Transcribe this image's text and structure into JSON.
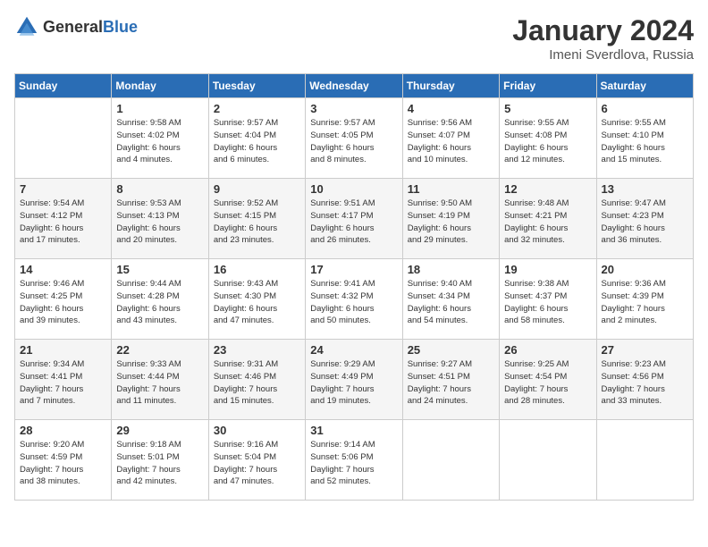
{
  "logo": {
    "general": "General",
    "blue": "Blue"
  },
  "title": "January 2024",
  "location": "Imeni Sverdlova, Russia",
  "days_header": [
    "Sunday",
    "Monday",
    "Tuesday",
    "Wednesday",
    "Thursday",
    "Friday",
    "Saturday"
  ],
  "weeks": [
    [
      {
        "day": "",
        "info": ""
      },
      {
        "day": "1",
        "info": "Sunrise: 9:58 AM\nSunset: 4:02 PM\nDaylight: 6 hours\nand 4 minutes."
      },
      {
        "day": "2",
        "info": "Sunrise: 9:57 AM\nSunset: 4:04 PM\nDaylight: 6 hours\nand 6 minutes."
      },
      {
        "day": "3",
        "info": "Sunrise: 9:57 AM\nSunset: 4:05 PM\nDaylight: 6 hours\nand 8 minutes."
      },
      {
        "day": "4",
        "info": "Sunrise: 9:56 AM\nSunset: 4:07 PM\nDaylight: 6 hours\nand 10 minutes."
      },
      {
        "day": "5",
        "info": "Sunrise: 9:55 AM\nSunset: 4:08 PM\nDaylight: 6 hours\nand 12 minutes."
      },
      {
        "day": "6",
        "info": "Sunrise: 9:55 AM\nSunset: 4:10 PM\nDaylight: 6 hours\nand 15 minutes."
      }
    ],
    [
      {
        "day": "7",
        "info": "Sunrise: 9:54 AM\nSunset: 4:12 PM\nDaylight: 6 hours\nand 17 minutes."
      },
      {
        "day": "8",
        "info": "Sunrise: 9:53 AM\nSunset: 4:13 PM\nDaylight: 6 hours\nand 20 minutes."
      },
      {
        "day": "9",
        "info": "Sunrise: 9:52 AM\nSunset: 4:15 PM\nDaylight: 6 hours\nand 23 minutes."
      },
      {
        "day": "10",
        "info": "Sunrise: 9:51 AM\nSunset: 4:17 PM\nDaylight: 6 hours\nand 26 minutes."
      },
      {
        "day": "11",
        "info": "Sunrise: 9:50 AM\nSunset: 4:19 PM\nDaylight: 6 hours\nand 29 minutes."
      },
      {
        "day": "12",
        "info": "Sunrise: 9:48 AM\nSunset: 4:21 PM\nDaylight: 6 hours\nand 32 minutes."
      },
      {
        "day": "13",
        "info": "Sunrise: 9:47 AM\nSunset: 4:23 PM\nDaylight: 6 hours\nand 36 minutes."
      }
    ],
    [
      {
        "day": "14",
        "info": "Sunrise: 9:46 AM\nSunset: 4:25 PM\nDaylight: 6 hours\nand 39 minutes."
      },
      {
        "day": "15",
        "info": "Sunrise: 9:44 AM\nSunset: 4:28 PM\nDaylight: 6 hours\nand 43 minutes."
      },
      {
        "day": "16",
        "info": "Sunrise: 9:43 AM\nSunset: 4:30 PM\nDaylight: 6 hours\nand 47 minutes."
      },
      {
        "day": "17",
        "info": "Sunrise: 9:41 AM\nSunset: 4:32 PM\nDaylight: 6 hours\nand 50 minutes."
      },
      {
        "day": "18",
        "info": "Sunrise: 9:40 AM\nSunset: 4:34 PM\nDaylight: 6 hours\nand 54 minutes."
      },
      {
        "day": "19",
        "info": "Sunrise: 9:38 AM\nSunset: 4:37 PM\nDaylight: 6 hours\nand 58 minutes."
      },
      {
        "day": "20",
        "info": "Sunrise: 9:36 AM\nSunset: 4:39 PM\nDaylight: 7 hours\nand 2 minutes."
      }
    ],
    [
      {
        "day": "21",
        "info": "Sunrise: 9:34 AM\nSunset: 4:41 PM\nDaylight: 7 hours\nand 7 minutes."
      },
      {
        "day": "22",
        "info": "Sunrise: 9:33 AM\nSunset: 4:44 PM\nDaylight: 7 hours\nand 11 minutes."
      },
      {
        "day": "23",
        "info": "Sunrise: 9:31 AM\nSunset: 4:46 PM\nDaylight: 7 hours\nand 15 minutes."
      },
      {
        "day": "24",
        "info": "Sunrise: 9:29 AM\nSunset: 4:49 PM\nDaylight: 7 hours\nand 19 minutes."
      },
      {
        "day": "25",
        "info": "Sunrise: 9:27 AM\nSunset: 4:51 PM\nDaylight: 7 hours\nand 24 minutes."
      },
      {
        "day": "26",
        "info": "Sunrise: 9:25 AM\nSunset: 4:54 PM\nDaylight: 7 hours\nand 28 minutes."
      },
      {
        "day": "27",
        "info": "Sunrise: 9:23 AM\nSunset: 4:56 PM\nDaylight: 7 hours\nand 33 minutes."
      }
    ],
    [
      {
        "day": "28",
        "info": "Sunrise: 9:20 AM\nSunset: 4:59 PM\nDaylight: 7 hours\nand 38 minutes."
      },
      {
        "day": "29",
        "info": "Sunrise: 9:18 AM\nSunset: 5:01 PM\nDaylight: 7 hours\nand 42 minutes."
      },
      {
        "day": "30",
        "info": "Sunrise: 9:16 AM\nSunset: 5:04 PM\nDaylight: 7 hours\nand 47 minutes."
      },
      {
        "day": "31",
        "info": "Sunrise: 9:14 AM\nSunset: 5:06 PM\nDaylight: 7 hours\nand 52 minutes."
      },
      {
        "day": "",
        "info": ""
      },
      {
        "day": "",
        "info": ""
      },
      {
        "day": "",
        "info": ""
      }
    ]
  ]
}
